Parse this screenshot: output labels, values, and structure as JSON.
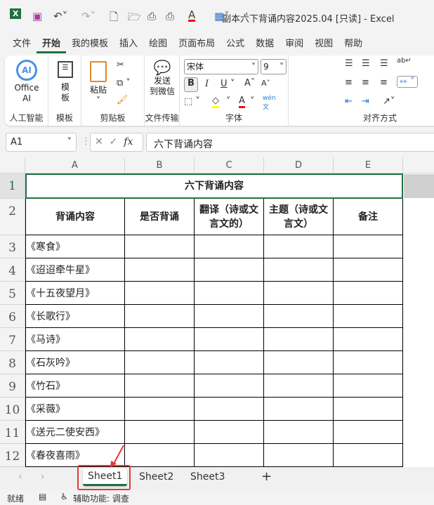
{
  "window": {
    "title": "副本六下背诵内容2025.04  [只读]  -  Excel"
  },
  "ribbon_tabs": [
    "文件",
    "开始",
    "我的模板",
    "插入",
    "绘图",
    "页面布局",
    "公式",
    "数据",
    "审阅",
    "视图",
    "帮助"
  ],
  "ribbon": {
    "ai": {
      "label1": "Office",
      "label2": "AI",
      "group": "人工智能"
    },
    "template": {
      "label1": "模",
      "label2": "板",
      "group": "模板"
    },
    "clipboard": {
      "paste": "粘贴",
      "group": "剪贴板"
    },
    "transfer": {
      "label1": "发送",
      "label2": "到微信",
      "group": "文件传输"
    },
    "font": {
      "name": "宋体",
      "size": "9",
      "bold": "B",
      "italic": "I",
      "underline": "U",
      "group": "字体",
      "font_color": "#ff0000",
      "fill_color": "#ffff00"
    },
    "align": {
      "group": "对齐方式"
    }
  },
  "formula_bar": {
    "name_box": "A1",
    "fx": "fx",
    "value": "六下背诵内容"
  },
  "columns": [
    "A",
    "B",
    "C",
    "D",
    "E"
  ],
  "rows": [
    "1",
    "2",
    "3",
    "4",
    "5",
    "6",
    "7",
    "8",
    "9",
    "10",
    "11",
    "12"
  ],
  "sheet": {
    "title": "六下背诵内容",
    "headers": [
      "背诵内容",
      "是否背诵",
      "翻译（诗或文言文的）",
      "主题（诗或文言文）",
      "备注"
    ],
    "items": [
      "《寒食》",
      "《迢迢牵牛星》",
      "《十五夜望月》",
      "《长歌行》",
      "《马诗》",
      "《石灰吟》",
      "《竹石》",
      "《采薇》",
      "《送元二使安西》",
      "《春夜喜雨》"
    ]
  },
  "sheets": [
    "Sheet1",
    "Sheet2",
    "Sheet3"
  ],
  "active_sheet": "Sheet1",
  "status": {
    "ready": "就绪",
    "accessibility": "辅助功能: 调查"
  },
  "colors": {
    "accent": "#1e7145",
    "highlight_box": "#e53935"
  }
}
